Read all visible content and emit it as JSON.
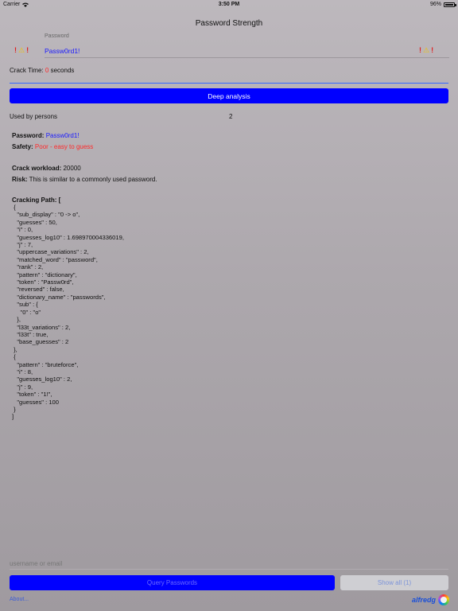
{
  "status_bar": {
    "carrier": "Carrier",
    "time": "3:50 PM",
    "battery_text": "96%",
    "battery_level": 0.96
  },
  "title": "Password Strength",
  "password_field": {
    "label": "Password",
    "value": "Passw0rd1!"
  },
  "crack_time": {
    "label": "Crack Time:",
    "value": "0",
    "unit": "seconds"
  },
  "deep_analysis_label": "Deep analysis",
  "used_by": {
    "label": "Used by persons",
    "count": "2"
  },
  "details": {
    "password_label": "Password:",
    "password_value": "Passw0rd1!",
    "safety_label": "Safety:",
    "safety_value": "Poor - easy to guess",
    "workload_label": "Crack workload:",
    "workload_value": "20000",
    "risk_label": "Risk:",
    "risk_value": "This is similar to a commonly used password."
  },
  "cracking_path_label": "Cracking Path: [",
  "cracking_path_json": " {\n   \"sub_display\" : \"0 -> o\",\n   \"guesses\" : 50,\n   \"i\" : 0,\n   \"guesses_log10\" : 1.698970004336019,\n   \"j\" : 7,\n   \"uppercase_variations\" : 2,\n   \"matched_word\" : \"password\",\n   \"rank\" : 2,\n   \"pattern\" : \"dictionary\",\n   \"token\" : \"Passw0rd\",\n   \"reversed\" : false,\n   \"dictionary_name\" : \"passwords\",\n   \"sub\" : {\n     \"0\" : \"o\"\n   },\n   \"l33t_variations\" : 2,\n   \"l33t\" : true,\n   \"base_guesses\" : 2\n },\n {\n   \"pattern\" : \"bruteforce\",\n   \"i\" : 8,\n   \"guesses_log10\" : 2,\n   \"j\" : 9,\n   \"token\" : \"1!\",\n   \"guesses\" : 100\n }\n]",
  "query": {
    "placeholder": "username or email",
    "button_label": "Query Passwords",
    "show_all_label": "Show all (1)"
  },
  "footer": {
    "link_label": "About...",
    "brand": "alfredg"
  }
}
